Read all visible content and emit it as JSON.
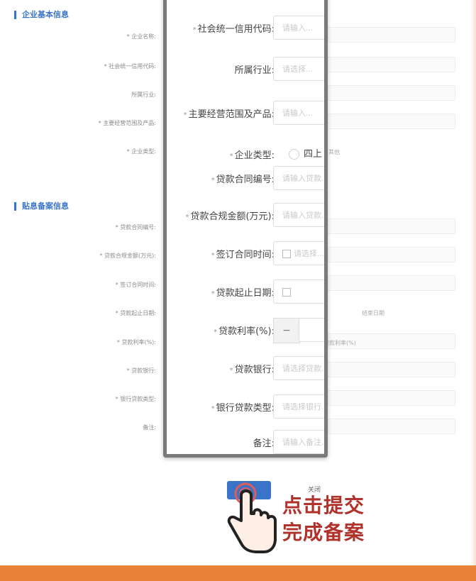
{
  "sections": {
    "company_info": "企业基本信息",
    "filing_info": "贴息备案信息"
  },
  "bg_labels": [
    "* 企业名称:",
    "* 社会统一信用代码:",
    "所属行业:",
    "* 主要经营范围及产品:",
    "* 企业类型:",
    "* 贷款合同编号:",
    "* 贷款合规金额(万元):",
    "* 签订合同时间:",
    "* 贷款起止日期:",
    "* 贷款利率(%):",
    "* 贷款银行:",
    "* 银行贷款类型:",
    "备注:"
  ],
  "bg_extras": {
    "other_option": "其他",
    "end_date": "结束日期",
    "rate_hint": "贷款利率(%)"
  },
  "zoom": {
    "fields": [
      {
        "label": "社会统一信用代码:",
        "required": true,
        "placeholder": "请输入..."
      },
      {
        "label": "所属行业:",
        "required": false,
        "placeholder": "请选择..."
      },
      {
        "label": "主要经营范围及产品:",
        "required": true,
        "placeholder": "请输入..."
      },
      {
        "label": "企业类型:",
        "required": true,
        "option": "四上"
      },
      {
        "label": "贷款合同编号:",
        "required": true,
        "placeholder": "请输入贷款..."
      },
      {
        "label": "贷款合规金额(万元):",
        "required": true,
        "placeholder": "请输入贷款..."
      },
      {
        "label": "签订合同时间:",
        "required": true,
        "placeholder": "请选择..."
      },
      {
        "label": "贷款起止日期:",
        "required": true,
        "placeholder": ""
      },
      {
        "label": "贷款利率(%):",
        "required": true,
        "minus": "−"
      },
      {
        "label": "贷款银行:",
        "required": true,
        "placeholder": "请选择贷款..."
      },
      {
        "label": "银行贷款类型:",
        "required": true,
        "placeholder": "请选择银行..."
      },
      {
        "label": "备注:",
        "required": false,
        "placeholder": "请输入备注..."
      }
    ]
  },
  "buttons": {
    "submit": "",
    "close": "关闭"
  },
  "callout": {
    "line1": "点击提交",
    "line2": "完成备案"
  },
  "colors": {
    "accent": "#3a74c9",
    "callout": "#b0322a",
    "bottom_bar": "#e9833a"
  },
  "icons": [
    "radio-icon",
    "calendar-icon",
    "pointing-hand-icon"
  ]
}
